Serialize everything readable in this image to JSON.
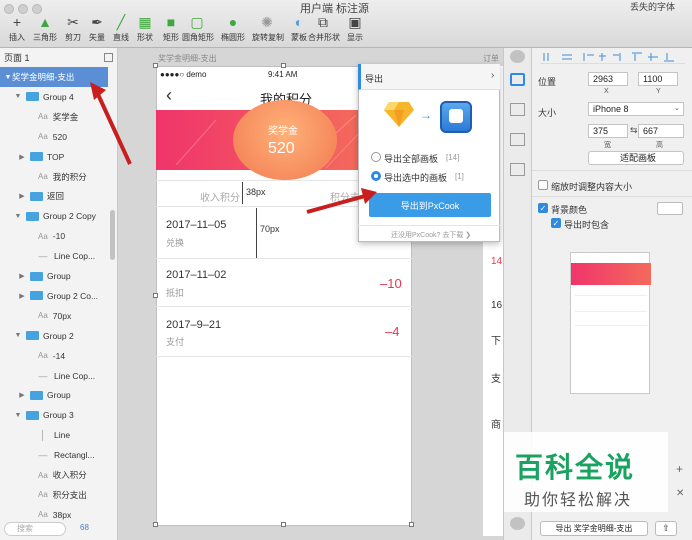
{
  "window": {
    "title": "用户端 标注源",
    "font_warning": "丢失的字体"
  },
  "toolbar": [
    {
      "label": "插入",
      "icon": "plus-icon"
    },
    {
      "label": "三角形",
      "icon": "triangle-icon"
    },
    {
      "label": "剪刀",
      "icon": "scissors-icon"
    },
    {
      "label": "矢量",
      "icon": "vector-pen-icon"
    },
    {
      "label": "直线",
      "icon": "line-icon"
    },
    {
      "label": "形状",
      "icon": "shape-icon"
    },
    {
      "label": "矩形",
      "icon": "rectangle-icon"
    },
    {
      "label": "圆角矩形",
      "icon": "rounded-rectangle-icon"
    },
    {
      "label": "椭圆形",
      "icon": "ellipse-icon"
    },
    {
      "label": "旋转复制",
      "icon": "rotate-copy-icon"
    },
    {
      "label": "蒙板",
      "icon": "mask-icon"
    },
    {
      "label": "合并形状",
      "icon": "combine-shapes-icon"
    },
    {
      "label": "显示",
      "icon": "view-icon"
    }
  ],
  "layers": {
    "page": "页面 1",
    "search_placeholder": "搜索",
    "count": "68",
    "items": [
      {
        "label": "奖学金明细-支出",
        "kind": "artboard"
      },
      {
        "label": "Group 4",
        "kind": "group-open"
      },
      {
        "label": "奖学金",
        "kind": "text"
      },
      {
        "label": "520",
        "kind": "text"
      },
      {
        "label": "TOP",
        "kind": "group"
      },
      {
        "label": "我的积分",
        "kind": "text"
      },
      {
        "label": "返回",
        "kind": "group"
      },
      {
        "label": "Group 2 Copy",
        "kind": "group-open"
      },
      {
        "label": "-10",
        "kind": "text"
      },
      {
        "label": "Line Cop...",
        "kind": "line"
      },
      {
        "label": "Group",
        "kind": "group"
      },
      {
        "label": "Group 2 Co...",
        "kind": "group"
      },
      {
        "label": "70px",
        "kind": "text"
      },
      {
        "label": "Group 2",
        "kind": "group-open"
      },
      {
        "label": "-14",
        "kind": "text"
      },
      {
        "label": "Line Cop...",
        "kind": "line"
      },
      {
        "label": "Group",
        "kind": "group"
      },
      {
        "label": "Group 3",
        "kind": "group-open"
      },
      {
        "label": "Line",
        "kind": "vline"
      },
      {
        "label": "Rectangl...",
        "kind": "line"
      },
      {
        "label": "收入积分",
        "kind": "text"
      },
      {
        "label": "积分支出",
        "kind": "text"
      },
      {
        "label": "38px",
        "kind": "text"
      }
    ]
  },
  "canvas": {
    "artboard_label": "奖学金明细-支出",
    "right_artboard_label": "订单",
    "status_carrier": "●●●●○ demo",
    "status_time": "9:41 AM",
    "nav_title": "我的积分",
    "banner_label": "奖学金",
    "banner_value": "520",
    "tab_income": "收入积分",
    "tab_expense": "积分支",
    "measure_38": "38px",
    "measure_70": "70px",
    "rows": [
      {
        "date": "2017–11–05",
        "type": "兑换"
      },
      {
        "date": "2017–11–02",
        "type": "抵扣",
        "amount": "–10"
      },
      {
        "date": "2017–9–21",
        "type": "支付",
        "amount": "–4"
      }
    ],
    "right_texts": [
      "14",
      "16",
      "下",
      "支",
      "商"
    ]
  },
  "popover": {
    "title": "导出",
    "option_all": "导出全部画板",
    "option_all_count": "[14]",
    "option_selected": "导出选中的画板",
    "option_selected_count": "[1]",
    "export_button": "导出到PxCook",
    "footer": "还没用PxCook? 去下载 ❯"
  },
  "inspector": {
    "position_label": "位置",
    "x_value": "2963",
    "y_value": "1100",
    "x_sub": "X",
    "y_sub": "Y",
    "size_label": "大小",
    "device": "iPhone 8",
    "width_value": "375",
    "height_value": "667",
    "width_sub": "宽",
    "height_sub": "高",
    "fit_button": "适配画板",
    "resize_content": "缩放时调整内容大小",
    "bg_color": "背景颜色",
    "include_on_export": "导出时包含",
    "export_bottom": "导出 奖学金明细-支出"
  },
  "watermark": {
    "main": "百科全说",
    "sub": "助你轻松解决"
  },
  "colors": {
    "accent": "#2e8be0",
    "banner_start": "#f0346a",
    "negative": "#f0344c",
    "selection": "#5a8fd6"
  }
}
